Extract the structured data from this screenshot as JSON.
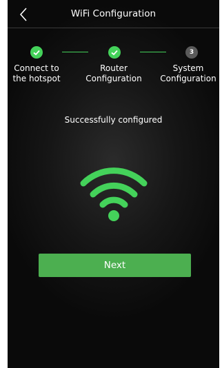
{
  "header": {
    "title": "WiFi Configuration",
    "back_icon": "chevron-left-icon"
  },
  "steps": [
    {
      "label": "Connect to\nthe hotspot",
      "state": "done"
    },
    {
      "label": "Router\nConfiguration",
      "state": "done"
    },
    {
      "label": "System\nConfiguration",
      "state": "pending",
      "number": "3"
    }
  ],
  "status_text": "Successfully configured",
  "next_label": "Next",
  "colors": {
    "accent": "#44d25a",
    "button": "#4caf50",
    "background": "#0a0a0a",
    "pending_step": "#5a5a5a"
  }
}
